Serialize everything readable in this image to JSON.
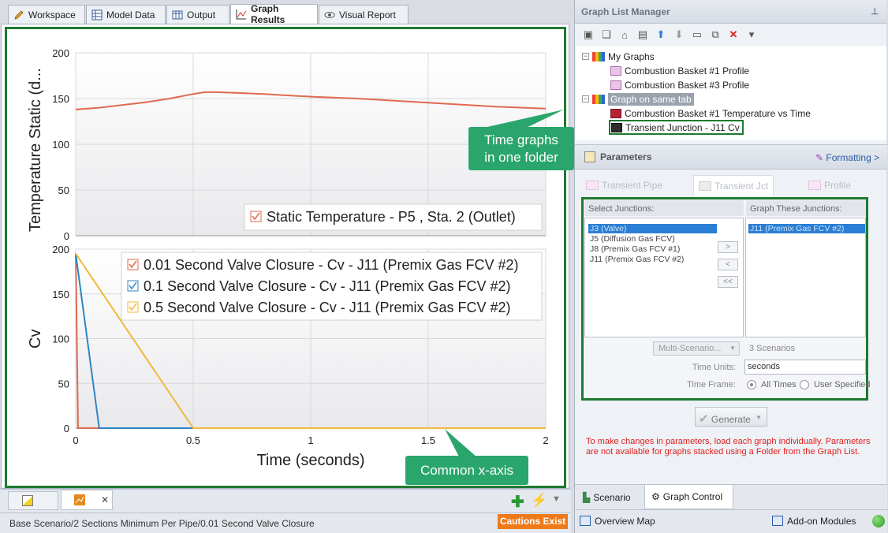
{
  "tabs": [
    {
      "label": "Workspace"
    },
    {
      "label": "Model Data"
    },
    {
      "label": "Output"
    },
    {
      "label": "Graph Results"
    },
    {
      "label": "Visual Report"
    }
  ],
  "chart_data": [
    {
      "type": "line",
      "ylabel": "Temperature Static (d...",
      "ylim": [
        0,
        200
      ],
      "yticks": [
        "200",
        "150",
        "100",
        "50",
        "0"
      ],
      "xlim": [
        0,
        2
      ],
      "series": [
        {
          "name": "Static Temperature - P5 , Sta. 2 (Outlet)",
          "color": "#e06a4f",
          "x": [
            0,
            0.1,
            0.2,
            0.3,
            0.4,
            0.5,
            0.55,
            0.6,
            0.7,
            0.8,
            1.0,
            1.2,
            1.4,
            1.6,
            1.8,
            2.0
          ],
          "y": [
            138,
            140,
            143,
            146,
            150,
            155,
            157,
            157,
            156,
            155,
            152,
            150,
            147,
            144,
            141,
            139
          ]
        }
      ]
    },
    {
      "type": "line",
      "ylabel": "Cv",
      "xlabel": "Time (seconds)",
      "ylim": [
        0,
        200
      ],
      "xlim": [
        0,
        2
      ],
      "yticks": [
        "200",
        "150",
        "100",
        "50",
        "0"
      ],
      "xticks": [
        "0",
        "0.5",
        "1",
        "1.5",
        "2"
      ],
      "series": [
        {
          "name": "0.01 Second Valve Closure - Cv - J11 (Premix Gas FCV #2)",
          "color": "#e06a4f",
          "x": [
            0,
            0.01,
            0.01,
            2
          ],
          "y": [
            195,
            0,
            0,
            0
          ]
        },
        {
          "name": "0.1 Second Valve Closure - Cv - J11 (Premix Gas FCV #2)",
          "color": "#2f86c5",
          "x": [
            0,
            0.1,
            2
          ],
          "y": [
            195,
            0,
            0
          ]
        },
        {
          "name": "0.5 Second Valve Closure - Cv - J11 (Premix Gas FCV #2)",
          "color": "#f0b93a",
          "x": [
            0,
            0.5,
            2
          ],
          "y": [
            195,
            0,
            0
          ]
        }
      ]
    }
  ],
  "callouts": {
    "time_graphs_1": "Time graphs",
    "time_graphs_2": "in one folder",
    "common_axis": "Common x-axis"
  },
  "bottom_tab_close": "✕",
  "status": {
    "text": "Base Scenario/2 Sections Minimum Per Pipe/0.01 Second Valve Closure",
    "cautions": "Cautions Exist"
  },
  "glm": {
    "title": "Graph List Manager",
    "pin": "⊥",
    "tree": [
      {
        "label": "My Graphs"
      },
      {
        "label": "Combustion Basket #1 Profile"
      },
      {
        "label": "Combustion Basket #3 Profile"
      },
      {
        "label": "Graph on same tab"
      },
      {
        "label": "Combustion Basket #1 Temperature vs Time"
      },
      {
        "label": "Transient Junction - J11 Cv"
      }
    ]
  },
  "params": {
    "title": "Parameters",
    "formatting": "Formatting >",
    "subtabs": [
      "Transient Pipe",
      "Transient Jct",
      "Profile"
    ],
    "select_label": "Select Junctions:",
    "graph_label": "Graph These Junctions:",
    "select_items": [
      "J3 (Valve)",
      "J5 (Diffusion Gas FCV)",
      "J8 (Premix Gas FCV #1)",
      "J11 (Premix Gas FCV #2)"
    ],
    "graph_items": [
      "J11 (Premix Gas FCV #2)"
    ],
    "btn_add": ">",
    "btn_remove": "<",
    "btn_remove_all": "<<",
    "multi": "Multi-Scenario...",
    "scenarios": "3 Scenarios",
    "time_units_label": "Time Units:",
    "time_units": "seconds",
    "time_frame_label": "Time Frame:",
    "all_times": "All Times",
    "user_specified": "User Specified",
    "generate": "Generate",
    "warning": "To make changes in parameters, load each graph individually. Parameters are not available for graphs stacked using a Folder from the Graph List."
  },
  "bottom_tabs": {
    "scenario": "Scenario",
    "graph_control": "Graph Control",
    "overview": "Overview Map",
    "addon": "Add-on Modules"
  }
}
